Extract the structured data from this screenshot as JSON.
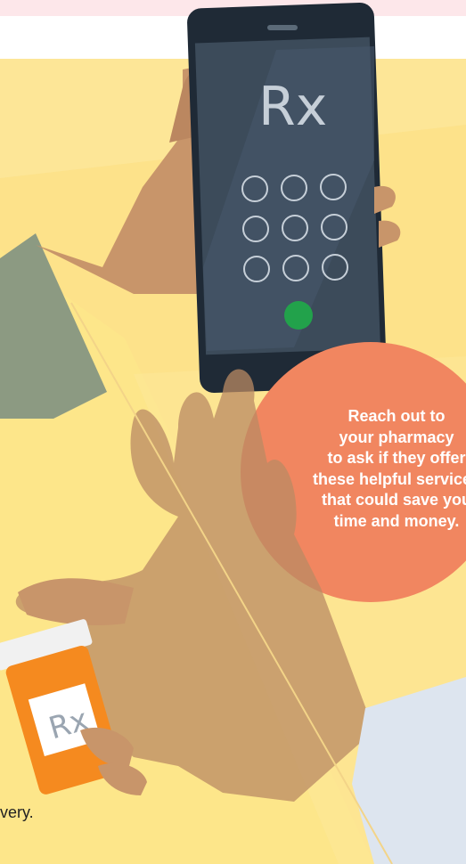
{
  "illustration": {
    "phone_glyph": "Rx",
    "bottle_glyph": "Rx",
    "colors": {
      "background": "#fde68a",
      "top_band": "#fde7ea",
      "bubble": "#f18660",
      "phone_body": "#1f2a36",
      "phone_screen": "#3c4b5a",
      "call_button": "#22a24b",
      "skin": "#c8956a",
      "bottle": "#f58a1f"
    }
  },
  "bubble": {
    "text": "Reach out to\nyour pharmacy\nto ask if they offer\nthese helpful services\nthat could save you\ntime and money."
  },
  "footer": {
    "text_fragment": "very."
  }
}
